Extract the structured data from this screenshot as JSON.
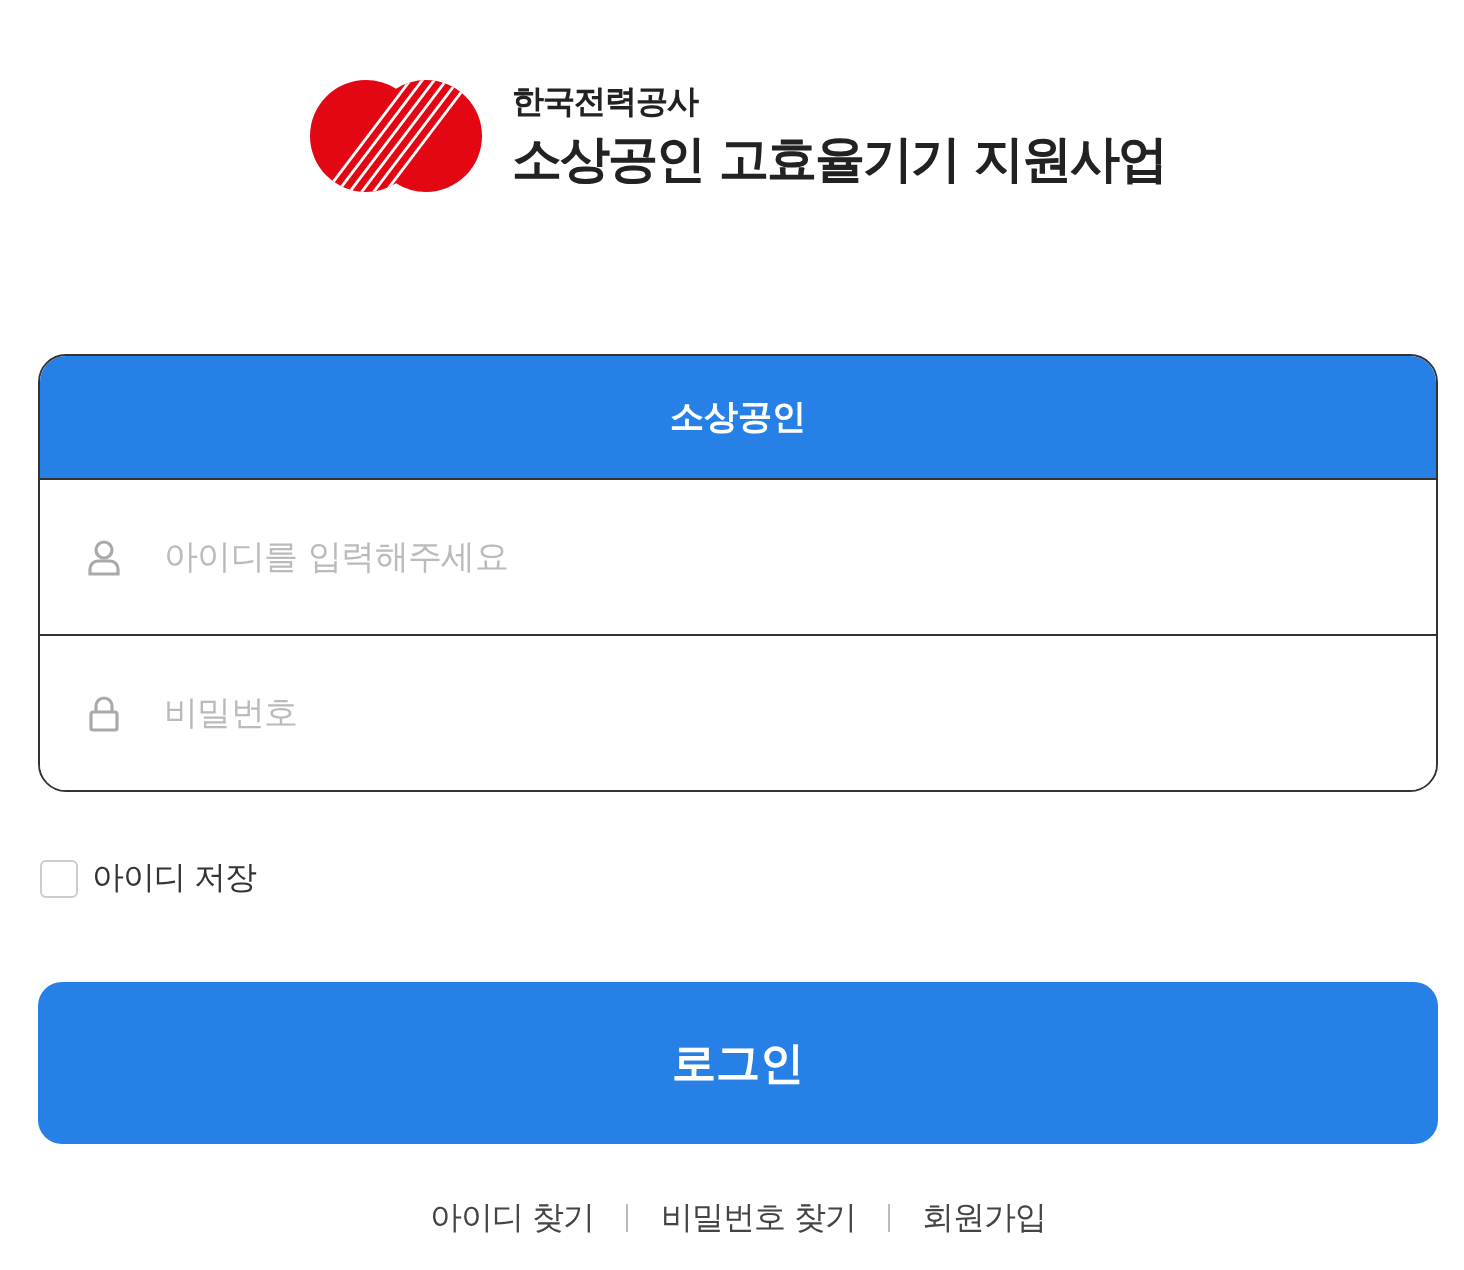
{
  "logo": {
    "company": "한국전력공사",
    "title": "소상공인 고효율기기 지원사업"
  },
  "login_form": {
    "header": "소상공인",
    "fields": [
      {
        "kind": "user",
        "placeholder": "아이디를 입력해주세요"
      },
      {
        "kind": "password",
        "placeholder": "비밀번호"
      }
    ]
  },
  "remember_id": {
    "label": "아이디 저장",
    "checked": false
  },
  "login_button": "로그인",
  "links": [
    "아이디 찾기",
    "비밀번호 찾기",
    "회원가입"
  ]
}
